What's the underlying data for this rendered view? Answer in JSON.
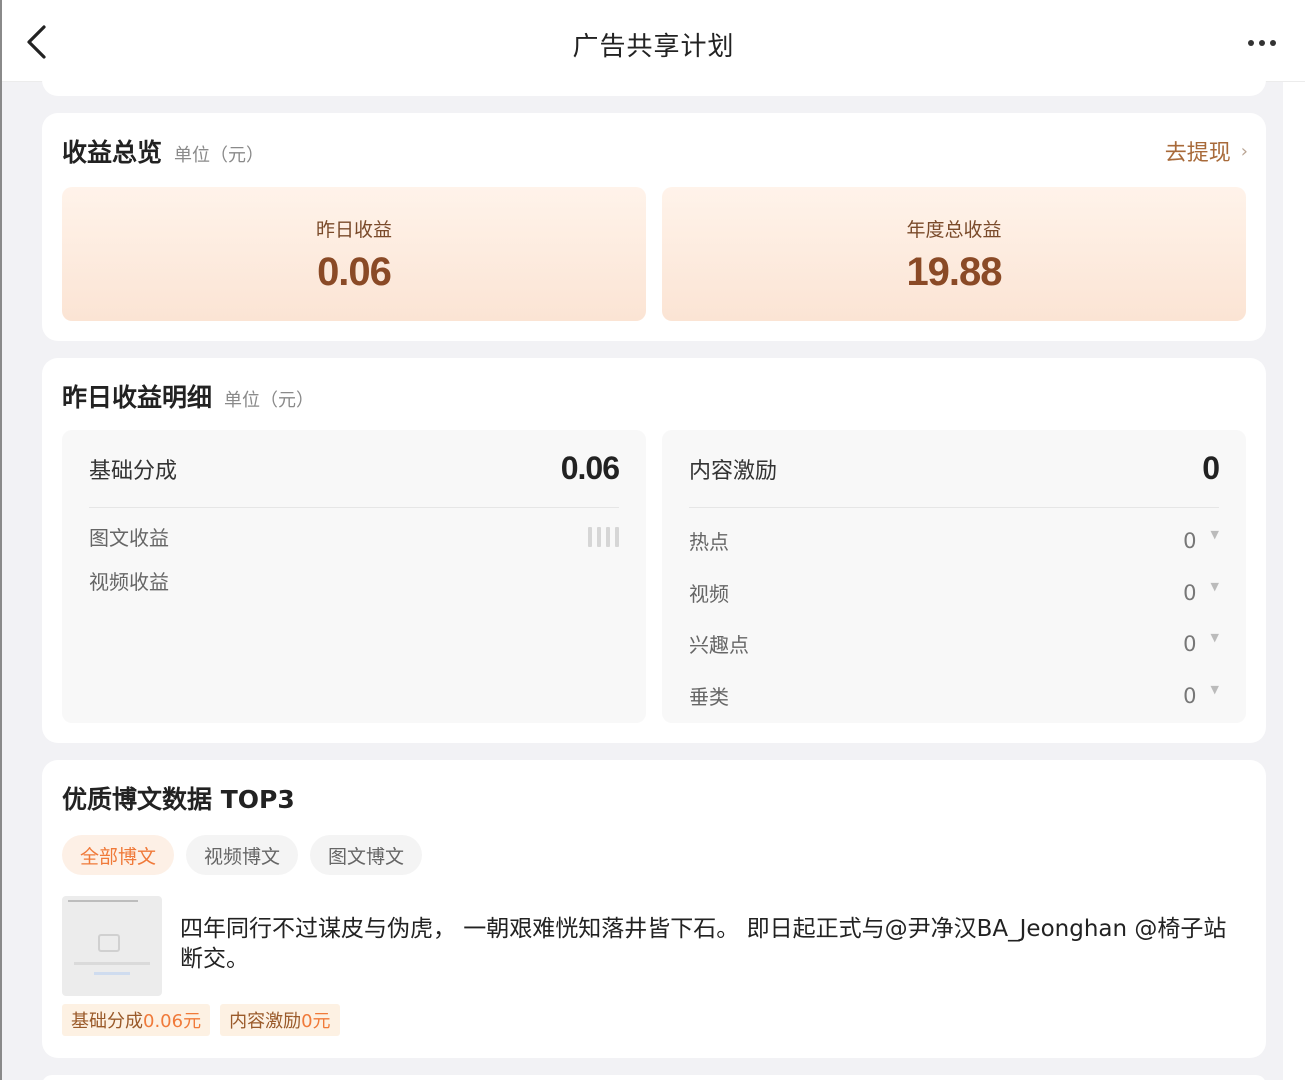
{
  "header": {
    "title": "广告共享计划"
  },
  "overview": {
    "title": "收益总览",
    "unit": "单位（元）",
    "withdraw_label": "去提现",
    "yesterday_label": "昨日收益",
    "yesterday_value": "0.06",
    "annual_label": "年度总收益",
    "annual_value": "19.88"
  },
  "detail": {
    "title": "昨日收益明细",
    "unit": "单位（元）",
    "base": {
      "label": "基础分成",
      "value": "0.06",
      "items": [
        {
          "label": "图文收益"
        },
        {
          "label": "视频收益"
        }
      ]
    },
    "incentive": {
      "label": "内容激励",
      "value": "0",
      "items": [
        {
          "label": "热点",
          "value": "0"
        },
        {
          "label": "视频",
          "value": "0"
        },
        {
          "label": "兴趣点",
          "value": "0"
        },
        {
          "label": "垂类",
          "value": "0"
        }
      ]
    }
  },
  "top3": {
    "title": "优质博文数据 TOP3",
    "tabs": [
      "全部博文",
      "视频博文",
      "图文博文"
    ],
    "active_tab": 0,
    "post": {
      "text": "四年同行不过谋皮与伪虎， 一朝艰难恍知落井皆下石。 即日起正式与@尹净汉BA_Jeonghan @椅子站 断交。",
      "base_label": "基础分成",
      "base_value": "0.06元",
      "incentive_label": "内容激励",
      "incentive_value": "0元"
    }
  },
  "colors": {
    "accent": "#f07a3a",
    "earn_value": "#8a4a26",
    "withdraw": "#a86a3a"
  }
}
